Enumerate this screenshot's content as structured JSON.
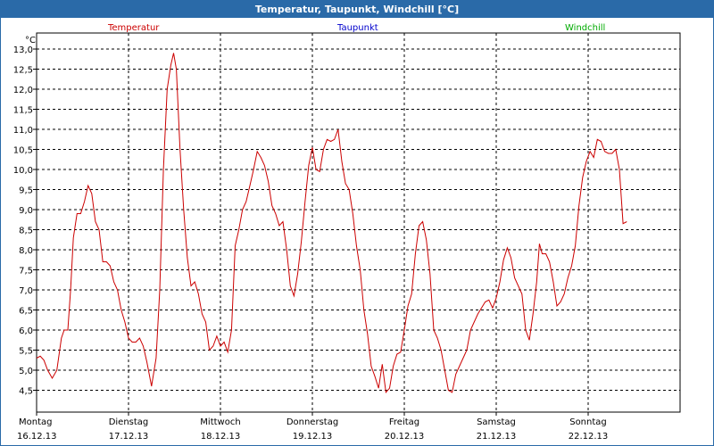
{
  "window": {
    "title": "Temperatur, Taupunkt, Windchill [°C]"
  },
  "chart_data": {
    "type": "line",
    "title": "Temperatur, Taupunkt, Windchill [°C]",
    "ylabel": "°C",
    "ylim": [
      4.1,
      13.4
    ],
    "yticks": [
      "13,0",
      "12,5",
      "12,0",
      "11,5",
      "11,0",
      "10,5",
      "10,0",
      "9,5",
      "9,0",
      "8,5",
      "8,0",
      "7,5",
      "7,0",
      "6,5",
      "6,0",
      "5,5",
      "5,0",
      "4,5"
    ],
    "xlim": [
      0,
      7.0
    ],
    "xticks": [
      {
        "day": "Montag",
        "date": "16.12.13"
      },
      {
        "day": "Dienstag",
        "date": "17.12.13"
      },
      {
        "day": "Mittwoch",
        "date": "18.12.13"
      },
      {
        "day": "Donnerstag",
        "date": "19.12.13"
      },
      {
        "day": "Freitag",
        "date": "20.12.13"
      },
      {
        "day": "Samstag",
        "date": "21.12.13"
      },
      {
        "day": "Sonntag",
        "date": "22.12.13"
      }
    ],
    "grid": true,
    "legend_position": "top",
    "series": [
      {
        "name": "Temperatur",
        "color": "#cc0000",
        "points": [
          [
            0.0,
            5.3
          ],
          [
            0.04,
            5.35
          ],
          [
            0.08,
            5.25
          ],
          [
            0.12,
            5.0
          ],
          [
            0.17,
            4.8
          ],
          [
            0.22,
            5.0
          ],
          [
            0.27,
            5.8
          ],
          [
            0.3,
            6.0
          ],
          [
            0.34,
            6.0
          ],
          [
            0.37,
            7.0
          ],
          [
            0.4,
            8.3
          ],
          [
            0.44,
            8.9
          ],
          [
            0.48,
            8.9
          ],
          [
            0.52,
            9.2
          ],
          [
            0.56,
            9.6
          ],
          [
            0.6,
            9.4
          ],
          [
            0.64,
            8.7
          ],
          [
            0.68,
            8.5
          ],
          [
            0.72,
            7.7
          ],
          [
            0.76,
            7.7
          ],
          [
            0.8,
            7.6
          ],
          [
            0.84,
            7.2
          ],
          [
            0.88,
            7.0
          ],
          [
            0.92,
            6.5
          ],
          [
            0.96,
            6.2
          ],
          [
            1.0,
            5.8
          ],
          [
            1.04,
            5.7
          ],
          [
            1.08,
            5.7
          ],
          [
            1.12,
            5.8
          ],
          [
            1.16,
            5.6
          ],
          [
            1.2,
            5.2
          ],
          [
            1.25,
            4.6
          ],
          [
            1.3,
            5.3
          ],
          [
            1.34,
            7.0
          ],
          [
            1.38,
            10.0
          ],
          [
            1.42,
            12.0
          ],
          [
            1.46,
            12.6
          ],
          [
            1.49,
            12.9
          ],
          [
            1.52,
            12.5
          ],
          [
            1.56,
            10.5
          ],
          [
            1.6,
            9.0
          ],
          [
            1.64,
            7.8
          ],
          [
            1.68,
            7.1
          ],
          [
            1.72,
            7.2
          ],
          [
            1.76,
            6.9
          ],
          [
            1.8,
            6.4
          ],
          [
            1.84,
            6.2
          ],
          [
            1.88,
            5.5
          ],
          [
            1.92,
            5.6
          ],
          [
            1.96,
            5.85
          ],
          [
            2.0,
            5.6
          ],
          [
            2.04,
            5.7
          ],
          [
            2.08,
            5.45
          ],
          [
            2.12,
            6.0
          ],
          [
            2.16,
            8.1
          ],
          [
            2.2,
            8.5
          ],
          [
            2.24,
            9.0
          ],
          [
            2.28,
            9.2
          ],
          [
            2.32,
            9.6
          ],
          [
            2.36,
            10.0
          ],
          [
            2.4,
            10.45
          ],
          [
            2.44,
            10.3
          ],
          [
            2.48,
            10.1
          ],
          [
            2.52,
            9.7
          ],
          [
            2.56,
            9.1
          ],
          [
            2.6,
            8.9
          ],
          [
            2.64,
            8.6
          ],
          [
            2.68,
            8.7
          ],
          [
            2.72,
            8.0
          ],
          [
            2.76,
            7.1
          ],
          [
            2.8,
            6.85
          ],
          [
            2.84,
            7.4
          ],
          [
            2.88,
            8.2
          ],
          [
            2.92,
            9.2
          ],
          [
            2.96,
            10.1
          ],
          [
            3.0,
            10.55
          ],
          [
            3.04,
            10.0
          ],
          [
            3.08,
            9.95
          ],
          [
            3.12,
            10.5
          ],
          [
            3.16,
            10.75
          ],
          [
            3.2,
            10.7
          ],
          [
            3.24,
            10.75
          ],
          [
            3.28,
            11.0
          ],
          [
            3.32,
            10.2
          ],
          [
            3.36,
            9.65
          ],
          [
            3.4,
            9.5
          ],
          [
            3.44,
            8.9
          ],
          [
            3.48,
            8.1
          ],
          [
            3.52,
            7.5
          ],
          [
            3.56,
            6.5
          ],
          [
            3.6,
            5.9
          ],
          [
            3.64,
            5.1
          ],
          [
            3.68,
            4.85
          ],
          [
            3.72,
            4.55
          ],
          [
            3.76,
            5.15
          ],
          [
            3.8,
            4.45
          ],
          [
            3.84,
            4.55
          ],
          [
            3.88,
            5.1
          ],
          [
            3.92,
            5.4
          ],
          [
            3.96,
            5.45
          ],
          [
            4.0,
            6.0
          ],
          [
            4.04,
            6.6
          ],
          [
            4.08,
            6.9
          ],
          [
            4.12,
            7.9
          ],
          [
            4.16,
            8.6
          ],
          [
            4.2,
            8.7
          ],
          [
            4.24,
            8.25
          ],
          [
            4.28,
            7.4
          ],
          [
            4.32,
            6.0
          ],
          [
            4.36,
            5.8
          ],
          [
            4.4,
            5.5
          ],
          [
            4.44,
            5.0
          ],
          [
            4.48,
            4.5
          ],
          [
            4.52,
            4.45
          ],
          [
            4.56,
            4.9
          ],
          [
            4.6,
            5.1
          ],
          [
            4.64,
            5.3
          ],
          [
            4.68,
            5.5
          ],
          [
            4.72,
            6.0
          ],
          [
            4.76,
            6.2
          ],
          [
            4.8,
            6.4
          ],
          [
            4.84,
            6.55
          ],
          [
            4.88,
            6.7
          ],
          [
            4.92,
            6.75
          ],
          [
            4.96,
            6.55
          ],
          [
            5.0,
            6.8
          ],
          [
            5.04,
            7.2
          ],
          [
            5.08,
            7.75
          ],
          [
            5.12,
            8.05
          ],
          [
            5.16,
            7.8
          ],
          [
            5.2,
            7.3
          ],
          [
            5.24,
            7.1
          ],
          [
            5.28,
            6.9
          ],
          [
            5.32,
            6.0
          ],
          [
            5.36,
            5.75
          ],
          [
            5.4,
            6.4
          ],
          [
            5.44,
            7.2
          ],
          [
            5.47,
            8.15
          ],
          [
            5.5,
            7.9
          ],
          [
            5.54,
            7.9
          ],
          [
            5.58,
            7.7
          ],
          [
            5.62,
            7.2
          ],
          [
            5.66,
            6.6
          ],
          [
            5.7,
            6.7
          ],
          [
            5.74,
            6.9
          ],
          [
            5.78,
            7.3
          ],
          [
            5.82,
            7.6
          ],
          [
            5.86,
            8.1
          ],
          [
            5.9,
            9.1
          ],
          [
            5.94,
            9.8
          ],
          [
            5.98,
            10.2
          ],
          [
            6.02,
            10.45
          ],
          [
            6.06,
            10.3
          ],
          [
            6.1,
            10.75
          ],
          [
            6.14,
            10.7
          ],
          [
            6.18,
            10.45
          ],
          [
            6.22,
            10.4
          ],
          [
            6.26,
            10.4
          ],
          [
            6.3,
            10.5
          ],
          [
            6.34,
            10.0
          ],
          [
            6.38,
            8.65
          ],
          [
            6.42,
            8.7
          ]
        ]
      },
      {
        "name": "Taupunkt",
        "color": "#0000cc",
        "points": []
      },
      {
        "name": "Windchill",
        "color": "#00aa00",
        "points": []
      }
    ]
  }
}
